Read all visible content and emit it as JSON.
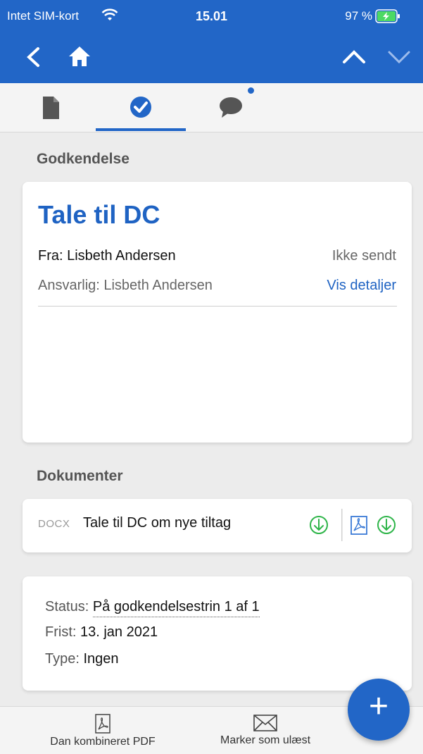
{
  "status_bar": {
    "carrier": "Intet SIM-kort",
    "time": "15.01",
    "battery": "97 %"
  },
  "nav": {
    "back_icon": "chevron-left-icon",
    "home_icon": "home-icon",
    "up_icon": "chevron-up-icon",
    "down_icon": "chevron-down-icon"
  },
  "tabs": [
    {
      "icon": "document-icon",
      "active": false
    },
    {
      "icon": "check-circle-icon",
      "active": true
    },
    {
      "icon": "chat-icon",
      "active": false,
      "badge": true
    }
  ],
  "approval": {
    "section_title": "Godkendelse",
    "title": "Tale til DC",
    "from": "Fra: Lisbeth Andersen",
    "status": "Ikke sendt",
    "responsible": "Ansvarlig: Lisbeth Andersen",
    "details_link": "Vis detaljer"
  },
  "documents": {
    "section_title": "Dokumenter",
    "items": [
      {
        "type": "DOCX",
        "name": "Tale til DC om nye tiltag"
      }
    ]
  },
  "meta": {
    "status_label": "Status:",
    "status_value": "På godkendelsestrin 1 af 1",
    "deadline_label": "Frist:",
    "deadline_value": "13. jan 2021",
    "type_label": "Type:",
    "type_value": "Ingen"
  },
  "bottom_bar": {
    "combined_pdf": "Dan kombineret PDF",
    "mark_unread": "Marker som ulæst"
  },
  "fab": {
    "label": "+"
  },
  "colors": {
    "primary": "#2266c7",
    "download_green": "#2fb54a",
    "pdf_blue": "#3a7ad6"
  }
}
